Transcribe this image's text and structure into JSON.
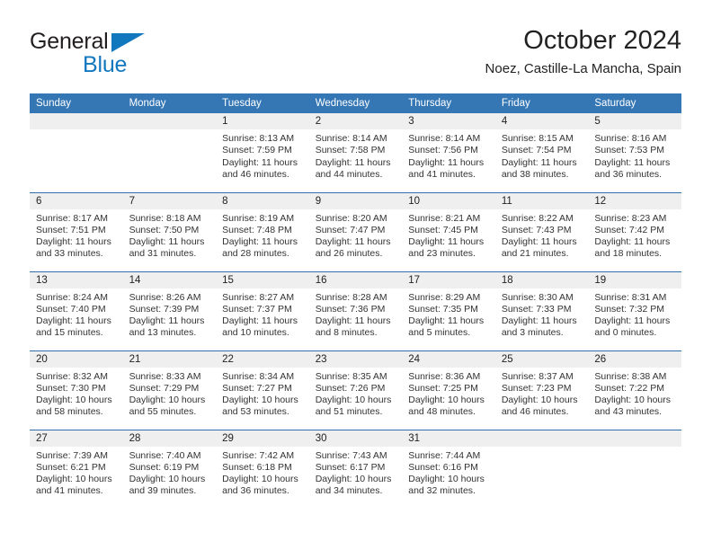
{
  "brand": {
    "name_part1": "General",
    "name_part2": "Blue",
    "triangle_icon": "blue-triangle-icon",
    "color_dark": "#231f20",
    "color_blue": "#1278be"
  },
  "header": {
    "title": "October 2024",
    "subtitle": "Noez, Castille-La Mancha, Spain"
  },
  "theme": {
    "header_blue": "#3577b5",
    "row_divider_blue": "#2f6fae",
    "daynum_band": "#efefef",
    "text": "#222222",
    "cell_text": "#333333"
  },
  "calendar": {
    "weekday_headers": [
      "Sunday",
      "Monday",
      "Tuesday",
      "Wednesday",
      "Thursday",
      "Friday",
      "Saturday"
    ],
    "weeks": [
      [
        {
          "day": "",
          "lines": []
        },
        {
          "day": "",
          "lines": []
        },
        {
          "day": "1",
          "lines": [
            "Sunrise: 8:13 AM",
            "Sunset: 7:59 PM",
            "Daylight: 11 hours",
            "and 46 minutes."
          ]
        },
        {
          "day": "2",
          "lines": [
            "Sunrise: 8:14 AM",
            "Sunset: 7:58 PM",
            "Daylight: 11 hours",
            "and 44 minutes."
          ]
        },
        {
          "day": "3",
          "lines": [
            "Sunrise: 8:14 AM",
            "Sunset: 7:56 PM",
            "Daylight: 11 hours",
            "and 41 minutes."
          ]
        },
        {
          "day": "4",
          "lines": [
            "Sunrise: 8:15 AM",
            "Sunset: 7:54 PM",
            "Daylight: 11 hours",
            "and 38 minutes."
          ]
        },
        {
          "day": "5",
          "lines": [
            "Sunrise: 8:16 AM",
            "Sunset: 7:53 PM",
            "Daylight: 11 hours",
            "and 36 minutes."
          ]
        }
      ],
      [
        {
          "day": "6",
          "lines": [
            "Sunrise: 8:17 AM",
            "Sunset: 7:51 PM",
            "Daylight: 11 hours",
            "and 33 minutes."
          ]
        },
        {
          "day": "7",
          "lines": [
            "Sunrise: 8:18 AM",
            "Sunset: 7:50 PM",
            "Daylight: 11 hours",
            "and 31 minutes."
          ]
        },
        {
          "day": "8",
          "lines": [
            "Sunrise: 8:19 AM",
            "Sunset: 7:48 PM",
            "Daylight: 11 hours",
            "and 28 minutes."
          ]
        },
        {
          "day": "9",
          "lines": [
            "Sunrise: 8:20 AM",
            "Sunset: 7:47 PM",
            "Daylight: 11 hours",
            "and 26 minutes."
          ]
        },
        {
          "day": "10",
          "lines": [
            "Sunrise: 8:21 AM",
            "Sunset: 7:45 PM",
            "Daylight: 11 hours",
            "and 23 minutes."
          ]
        },
        {
          "day": "11",
          "lines": [
            "Sunrise: 8:22 AM",
            "Sunset: 7:43 PM",
            "Daylight: 11 hours",
            "and 21 minutes."
          ]
        },
        {
          "day": "12",
          "lines": [
            "Sunrise: 8:23 AM",
            "Sunset: 7:42 PM",
            "Daylight: 11 hours",
            "and 18 minutes."
          ]
        }
      ],
      [
        {
          "day": "13",
          "lines": [
            "Sunrise: 8:24 AM",
            "Sunset: 7:40 PM",
            "Daylight: 11 hours",
            "and 15 minutes."
          ]
        },
        {
          "day": "14",
          "lines": [
            "Sunrise: 8:26 AM",
            "Sunset: 7:39 PM",
            "Daylight: 11 hours",
            "and 13 minutes."
          ]
        },
        {
          "day": "15",
          "lines": [
            "Sunrise: 8:27 AM",
            "Sunset: 7:37 PM",
            "Daylight: 11 hours",
            "and 10 minutes."
          ]
        },
        {
          "day": "16",
          "lines": [
            "Sunrise: 8:28 AM",
            "Sunset: 7:36 PM",
            "Daylight: 11 hours",
            "and 8 minutes."
          ]
        },
        {
          "day": "17",
          "lines": [
            "Sunrise: 8:29 AM",
            "Sunset: 7:35 PM",
            "Daylight: 11 hours",
            "and 5 minutes."
          ]
        },
        {
          "day": "18",
          "lines": [
            "Sunrise: 8:30 AM",
            "Sunset: 7:33 PM",
            "Daylight: 11 hours",
            "and 3 minutes."
          ]
        },
        {
          "day": "19",
          "lines": [
            "Sunrise: 8:31 AM",
            "Sunset: 7:32 PM",
            "Daylight: 11 hours",
            "and 0 minutes."
          ]
        }
      ],
      [
        {
          "day": "20",
          "lines": [
            "Sunrise: 8:32 AM",
            "Sunset: 7:30 PM",
            "Daylight: 10 hours",
            "and 58 minutes."
          ]
        },
        {
          "day": "21",
          "lines": [
            "Sunrise: 8:33 AM",
            "Sunset: 7:29 PM",
            "Daylight: 10 hours",
            "and 55 minutes."
          ]
        },
        {
          "day": "22",
          "lines": [
            "Sunrise: 8:34 AM",
            "Sunset: 7:27 PM",
            "Daylight: 10 hours",
            "and 53 minutes."
          ]
        },
        {
          "day": "23",
          "lines": [
            "Sunrise: 8:35 AM",
            "Sunset: 7:26 PM",
            "Daylight: 10 hours",
            "and 51 minutes."
          ]
        },
        {
          "day": "24",
          "lines": [
            "Sunrise: 8:36 AM",
            "Sunset: 7:25 PM",
            "Daylight: 10 hours",
            "and 48 minutes."
          ]
        },
        {
          "day": "25",
          "lines": [
            "Sunrise: 8:37 AM",
            "Sunset: 7:23 PM",
            "Daylight: 10 hours",
            "and 46 minutes."
          ]
        },
        {
          "day": "26",
          "lines": [
            "Sunrise: 8:38 AM",
            "Sunset: 7:22 PM",
            "Daylight: 10 hours",
            "and 43 minutes."
          ]
        }
      ],
      [
        {
          "day": "27",
          "lines": [
            "Sunrise: 7:39 AM",
            "Sunset: 6:21 PM",
            "Daylight: 10 hours",
            "and 41 minutes."
          ]
        },
        {
          "day": "28",
          "lines": [
            "Sunrise: 7:40 AM",
            "Sunset: 6:19 PM",
            "Daylight: 10 hours",
            "and 39 minutes."
          ]
        },
        {
          "day": "29",
          "lines": [
            "Sunrise: 7:42 AM",
            "Sunset: 6:18 PM",
            "Daylight: 10 hours",
            "and 36 minutes."
          ]
        },
        {
          "day": "30",
          "lines": [
            "Sunrise: 7:43 AM",
            "Sunset: 6:17 PM",
            "Daylight: 10 hours",
            "and 34 minutes."
          ]
        },
        {
          "day": "31",
          "lines": [
            "Sunrise: 7:44 AM",
            "Sunset: 6:16 PM",
            "Daylight: 10 hours",
            "and 32 minutes."
          ]
        },
        {
          "day": "",
          "lines": []
        },
        {
          "day": "",
          "lines": []
        }
      ]
    ]
  }
}
